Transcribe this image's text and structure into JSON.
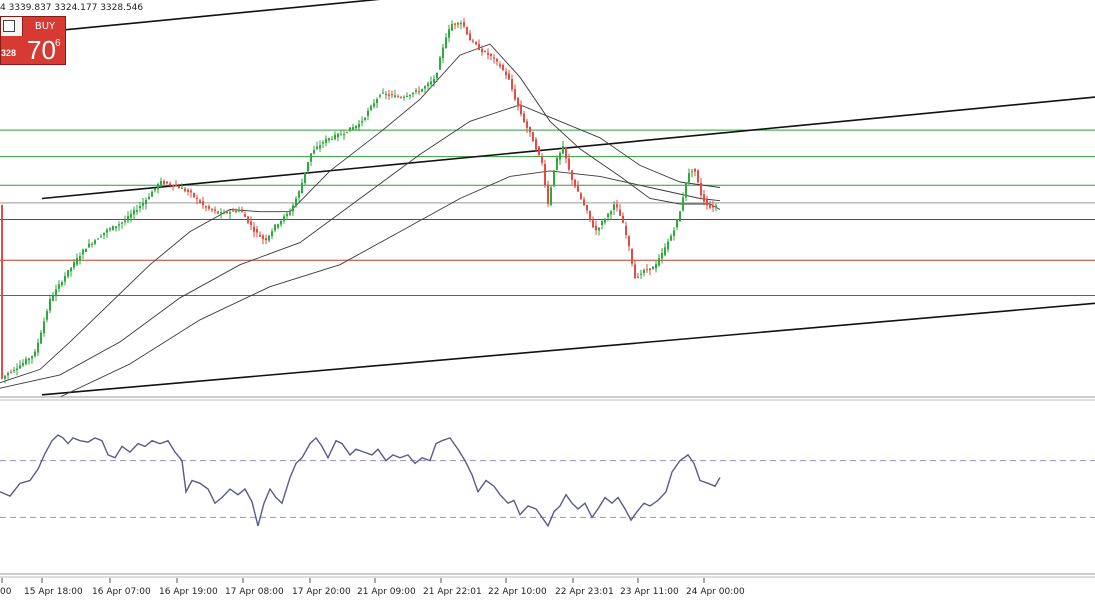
{
  "header": {
    "ohlc_text": "4 3339.837 3324.177 3328.546"
  },
  "trade_panel": {
    "buy_label": "BUY",
    "price_small": "328",
    "price_big": "70",
    "price_sup": "6"
  },
  "colors": {
    "bull": "#2eaa3c",
    "bear": "#e34b43",
    "ma": "#3a3a3a",
    "trendline": "#111111",
    "green_level": "#2e9e3a",
    "blue_level": "#1f5f8a",
    "red_level": "#c0392b",
    "grey_level": "#9a9a9a",
    "oscillator": "#5a5a8c",
    "osc_level": "#9b8fc7",
    "panel_border": "#999999",
    "trade_panel": "#d63a32"
  },
  "chart_data": [
    {
      "type": "candlestick",
      "title": "",
      "x_tick_labels": [
        "00",
        "15 Apr 18:00",
        "16 Apr 07:00",
        "16 Apr 19:00",
        "17 Apr 08:00",
        "17 Apr 20:00",
        "21 Apr 09:00",
        "21 Apr 22:01",
        "22 Apr 10:00",
        "22 Apr 23:01",
        "23 Apr 11:00",
        "24 Apr 00:00"
      ],
      "price_range": [
        3150,
        3510
      ],
      "path": [
        [
          0,
          3165
        ],
        [
          8,
          3172
        ],
        [
          22,
          3180
        ],
        [
          35,
          3190
        ],
        [
          50,
          3238
        ],
        [
          65,
          3260
        ],
        [
          85,
          3285
        ],
        [
          105,
          3300
        ],
        [
          125,
          3310
        ],
        [
          145,
          3328
        ],
        [
          160,
          3345
        ],
        [
          175,
          3342
        ],
        [
          190,
          3335
        ],
        [
          205,
          3322
        ],
        [
          220,
          3316
        ],
        [
          240,
          3320
        ],
        [
          255,
          3300
        ],
        [
          265,
          3292
        ],
        [
          275,
          3305
        ],
        [
          290,
          3318
        ],
        [
          300,
          3338
        ],
        [
          310,
          3370
        ],
        [
          325,
          3383
        ],
        [
          340,
          3388
        ],
        [
          360,
          3398
        ],
        [
          380,
          3425
        ],
        [
          400,
          3422
        ],
        [
          420,
          3428
        ],
        [
          435,
          3438
        ],
        [
          445,
          3475
        ],
        [
          452,
          3488
        ],
        [
          462,
          3490
        ],
        [
          470,
          3474
        ],
        [
          480,
          3465
        ],
        [
          492,
          3458
        ],
        [
          500,
          3450
        ],
        [
          508,
          3440
        ],
        [
          516,
          3418
        ],
        [
          524,
          3400
        ],
        [
          532,
          3385
        ],
        [
          542,
          3362
        ],
        [
          548,
          3325
        ],
        [
          555,
          3362
        ],
        [
          563,
          3376
        ],
        [
          570,
          3352
        ],
        [
          578,
          3335
        ],
        [
          588,
          3316
        ],
        [
          595,
          3300
        ],
        [
          605,
          3312
        ],
        [
          615,
          3325
        ],
        [
          622,
          3310
        ],
        [
          628,
          3290
        ],
        [
          635,
          3258
        ],
        [
          645,
          3265
        ],
        [
          655,
          3268
        ],
        [
          665,
          3285
        ],
        [
          673,
          3300
        ],
        [
          680,
          3318
        ],
        [
          687,
          3350
        ],
        [
          694,
          3358
        ],
        [
          702,
          3330
        ],
        [
          710,
          3322
        ],
        [
          718,
          3324
        ]
      ],
      "ma_lines": [
        {
          "points": [
            [
              0,
              3163
            ],
            [
              40,
              3175
            ],
            [
              70,
              3200
            ],
            [
              110,
              3235
            ],
            [
              150,
              3270
            ],
            [
              190,
              3300
            ],
            [
              230,
              3320
            ],
            [
              260,
              3318
            ],
            [
              290,
              3318
            ],
            [
              330,
              3355
            ],
            [
              380,
              3390
            ],
            [
              420,
              3420
            ],
            [
              460,
              3460
            ],
            [
              490,
              3470
            ],
            [
              520,
              3440
            ],
            [
              550,
              3400
            ],
            [
              580,
              3375
            ],
            [
              620,
              3350
            ],
            [
              650,
              3330
            ],
            [
              680,
              3325
            ],
            [
              710,
              3325
            ],
            [
              720,
              3320
            ]
          ]
        },
        {
          "points": [
            [
              0,
              3158
            ],
            [
              60,
              3170
            ],
            [
              120,
              3200
            ],
            [
              180,
              3240
            ],
            [
              240,
              3270
            ],
            [
              300,
              3290
            ],
            [
              360,
              3330
            ],
            [
              420,
              3370
            ],
            [
              470,
              3400
            ],
            [
              520,
              3415
            ],
            [
              560,
              3400
            ],
            [
              600,
              3385
            ],
            [
              640,
              3360
            ],
            [
              680,
              3345
            ],
            [
              720,
              3340
            ]
          ]
        },
        {
          "points": [
            [
              60,
              3150
            ],
            [
              130,
              3180
            ],
            [
              200,
              3220
            ],
            [
              270,
              3250
            ],
            [
              340,
              3270
            ],
            [
              400,
              3300
            ],
            [
              460,
              3330
            ],
            [
              510,
              3350
            ],
            [
              550,
              3355
            ],
            [
              600,
              3350
            ],
            [
              650,
              3340
            ],
            [
              700,
              3330
            ],
            [
              720,
              3328
            ]
          ]
        }
      ],
      "trendlines": [
        {
          "from": [
            65,
            3483
          ],
          "to": [
            770,
            3545
          ]
        },
        {
          "from": [
            42,
            3330
          ],
          "to": [
            1095,
            3422
          ]
        },
        {
          "from": [
            42,
            3152
          ],
          "to": [
            1095,
            3235
          ]
        }
      ],
      "horizontal_levels": [
        {
          "price": 3392,
          "kind": "green"
        },
        {
          "price": 3368,
          "kind": "green"
        },
        {
          "price": 3342,
          "kind": "green"
        },
        {
          "price": 3326,
          "kind": "grey"
        },
        {
          "price": 3311,
          "kind": "blue"
        },
        {
          "price": 3274,
          "kind": "red"
        },
        {
          "price": 3242,
          "kind": "red"
        }
      ]
    },
    {
      "type": "line",
      "title": "",
      "y_range": [
        0,
        100
      ],
      "levels": [
        70,
        30
      ],
      "values": [
        [
          0,
          48
        ],
        [
          10,
          45
        ],
        [
          20,
          54
        ],
        [
          30,
          56
        ],
        [
          38,
          64
        ],
        [
          45,
          75
        ],
        [
          52,
          84
        ],
        [
          58,
          88
        ],
        [
          63,
          86
        ],
        [
          68,
          82
        ],
        [
          73,
          86
        ],
        [
          80,
          84
        ],
        [
          88,
          83
        ],
        [
          95,
          86
        ],
        [
          102,
          84
        ],
        [
          108,
          74
        ],
        [
          115,
          72
        ],
        [
          122,
          80
        ],
        [
          130,
          76
        ],
        [
          138,
          82
        ],
        [
          145,
          80
        ],
        [
          152,
          84
        ],
        [
          160,
          82
        ],
        [
          168,
          84
        ],
        [
          175,
          76
        ],
        [
          182,
          70
        ],
        [
          186,
          48
        ],
        [
          192,
          56
        ],
        [
          200,
          54
        ],
        [
          208,
          50
        ],
        [
          215,
          40
        ],
        [
          222,
          44
        ],
        [
          230,
          50
        ],
        [
          238,
          46
        ],
        [
          245,
          50
        ],
        [
          252,
          41
        ],
        [
          258,
          24
        ],
        [
          264,
          40
        ],
        [
          270,
          50
        ],
        [
          276,
          44
        ],
        [
          282,
          40
        ],
        [
          290,
          58
        ],
        [
          296,
          68
        ],
        [
          302,
          72
        ],
        [
          310,
          82
        ],
        [
          316,
          86
        ],
        [
          322,
          80
        ],
        [
          328,
          72
        ],
        [
          336,
          84
        ],
        [
          342,
          82
        ],
        [
          350,
          74
        ],
        [
          356,
          78
        ],
        [
          364,
          76
        ],
        [
          372,
          74
        ],
        [
          378,
          78
        ],
        [
          386,
          70
        ],
        [
          393,
          74
        ],
        [
          400,
          72
        ],
        [
          408,
          74
        ],
        [
          415,
          68
        ],
        [
          422,
          72
        ],
        [
          430,
          70
        ],
        [
          436,
          82
        ],
        [
          442,
          84
        ],
        [
          450,
          86
        ],
        [
          458,
          78
        ],
        [
          465,
          70
        ],
        [
          472,
          60
        ],
        [
          478,
          48
        ],
        [
          486,
          56
        ],
        [
          494,
          52
        ],
        [
          500,
          46
        ],
        [
          508,
          40
        ],
        [
          514,
          42
        ],
        [
          520,
          32
        ],
        [
          528,
          38
        ],
        [
          536,
          36
        ],
        [
          542,
          30
        ],
        [
          548,
          24
        ],
        [
          554,
          34
        ],
        [
          560,
          38
        ],
        [
          566,
          46
        ],
        [
          572,
          40
        ],
        [
          578,
          36
        ],
        [
          585,
          40
        ],
        [
          592,
          30
        ],
        [
          598,
          36
        ],
        [
          605,
          44
        ],
        [
          612,
          40
        ],
        [
          618,
          44
        ],
        [
          625,
          36
        ],
        [
          631,
          28
        ],
        [
          637,
          34
        ],
        [
          644,
          40
        ],
        [
          650,
          38
        ],
        [
          658,
          42
        ],
        [
          666,
          48
        ],
        [
          672,
          62
        ],
        [
          680,
          70
        ],
        [
          688,
          74
        ],
        [
          694,
          68
        ],
        [
          700,
          56
        ],
        [
          708,
          54
        ],
        [
          715,
          52
        ],
        [
          720,
          58
        ]
      ]
    }
  ]
}
